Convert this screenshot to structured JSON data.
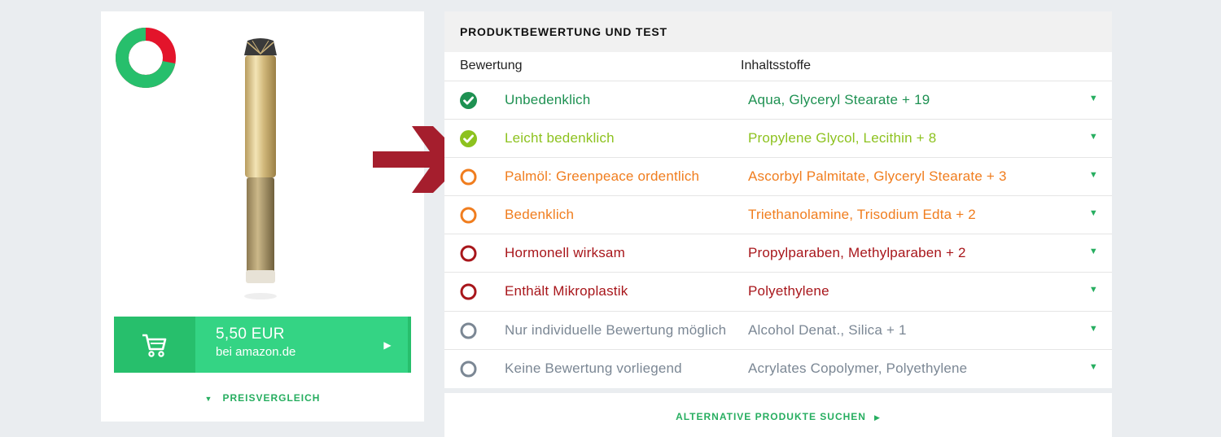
{
  "product": {
    "score_donut": {
      "green_fraction": 0.72,
      "red_fraction": 0.28,
      "green": "#27bf6c",
      "red": "#e3142b"
    },
    "buy": {
      "price": "5,50 EUR",
      "source": "bei amazon.de",
      "cart_icon": "cart-icon",
      "play_icon": "play-icon"
    },
    "price_compare_label": "PREISVERGLEICH"
  },
  "rating": {
    "title": "PRODUKTBEWERTUNG UND TEST",
    "col_rating": "Bewertung",
    "col_ingredients": "Inhaltsstoffe",
    "rows": [
      {
        "label": "Unbedenklich",
        "ingredients": "Aqua, Glyceryl Stearate + 19",
        "icon": "check",
        "color": "#1e9152"
      },
      {
        "label": "Leicht bedenklich",
        "ingredients": "Propylene Glycol, Lecithin + 8",
        "icon": "check",
        "color": "#8dc21f"
      },
      {
        "label": "Palmöl: Greenpeace ordentlich",
        "ingredients": "Ascorbyl Palmitate, Glyceryl Stearate + 3",
        "icon": "ring",
        "color": "#f07d1e"
      },
      {
        "label": "Bedenklich",
        "ingredients": "Triethanolamine, Trisodium Edta + 2",
        "icon": "ring",
        "color": "#f07d1e"
      },
      {
        "label": "Hormonell wirksam",
        "ingredients": "Propylparaben, Methylparaben + 2",
        "icon": "ring",
        "color": "#a8161b"
      },
      {
        "label": "Enthält Mikroplastik",
        "ingredients": "Polyethylene",
        "icon": "ring",
        "color": "#a8161b"
      },
      {
        "label": "Nur individuelle Bewertung möglich",
        "ingredients": "Alcohol Denat., Silica + 1",
        "icon": "ring",
        "color": "#7b8794"
      },
      {
        "label": "Keine Bewertung vorliegend",
        "ingredients": "Acrylates Copolymer, Polyethylene",
        "icon": "ring",
        "color": "#7b8794"
      }
    ]
  },
  "alternative_label": "ALTERNATIVE PRODUKTE SUCHEN",
  "colors": {
    "accent_green": "#27ae60",
    "arrow": "#a51e2d"
  }
}
